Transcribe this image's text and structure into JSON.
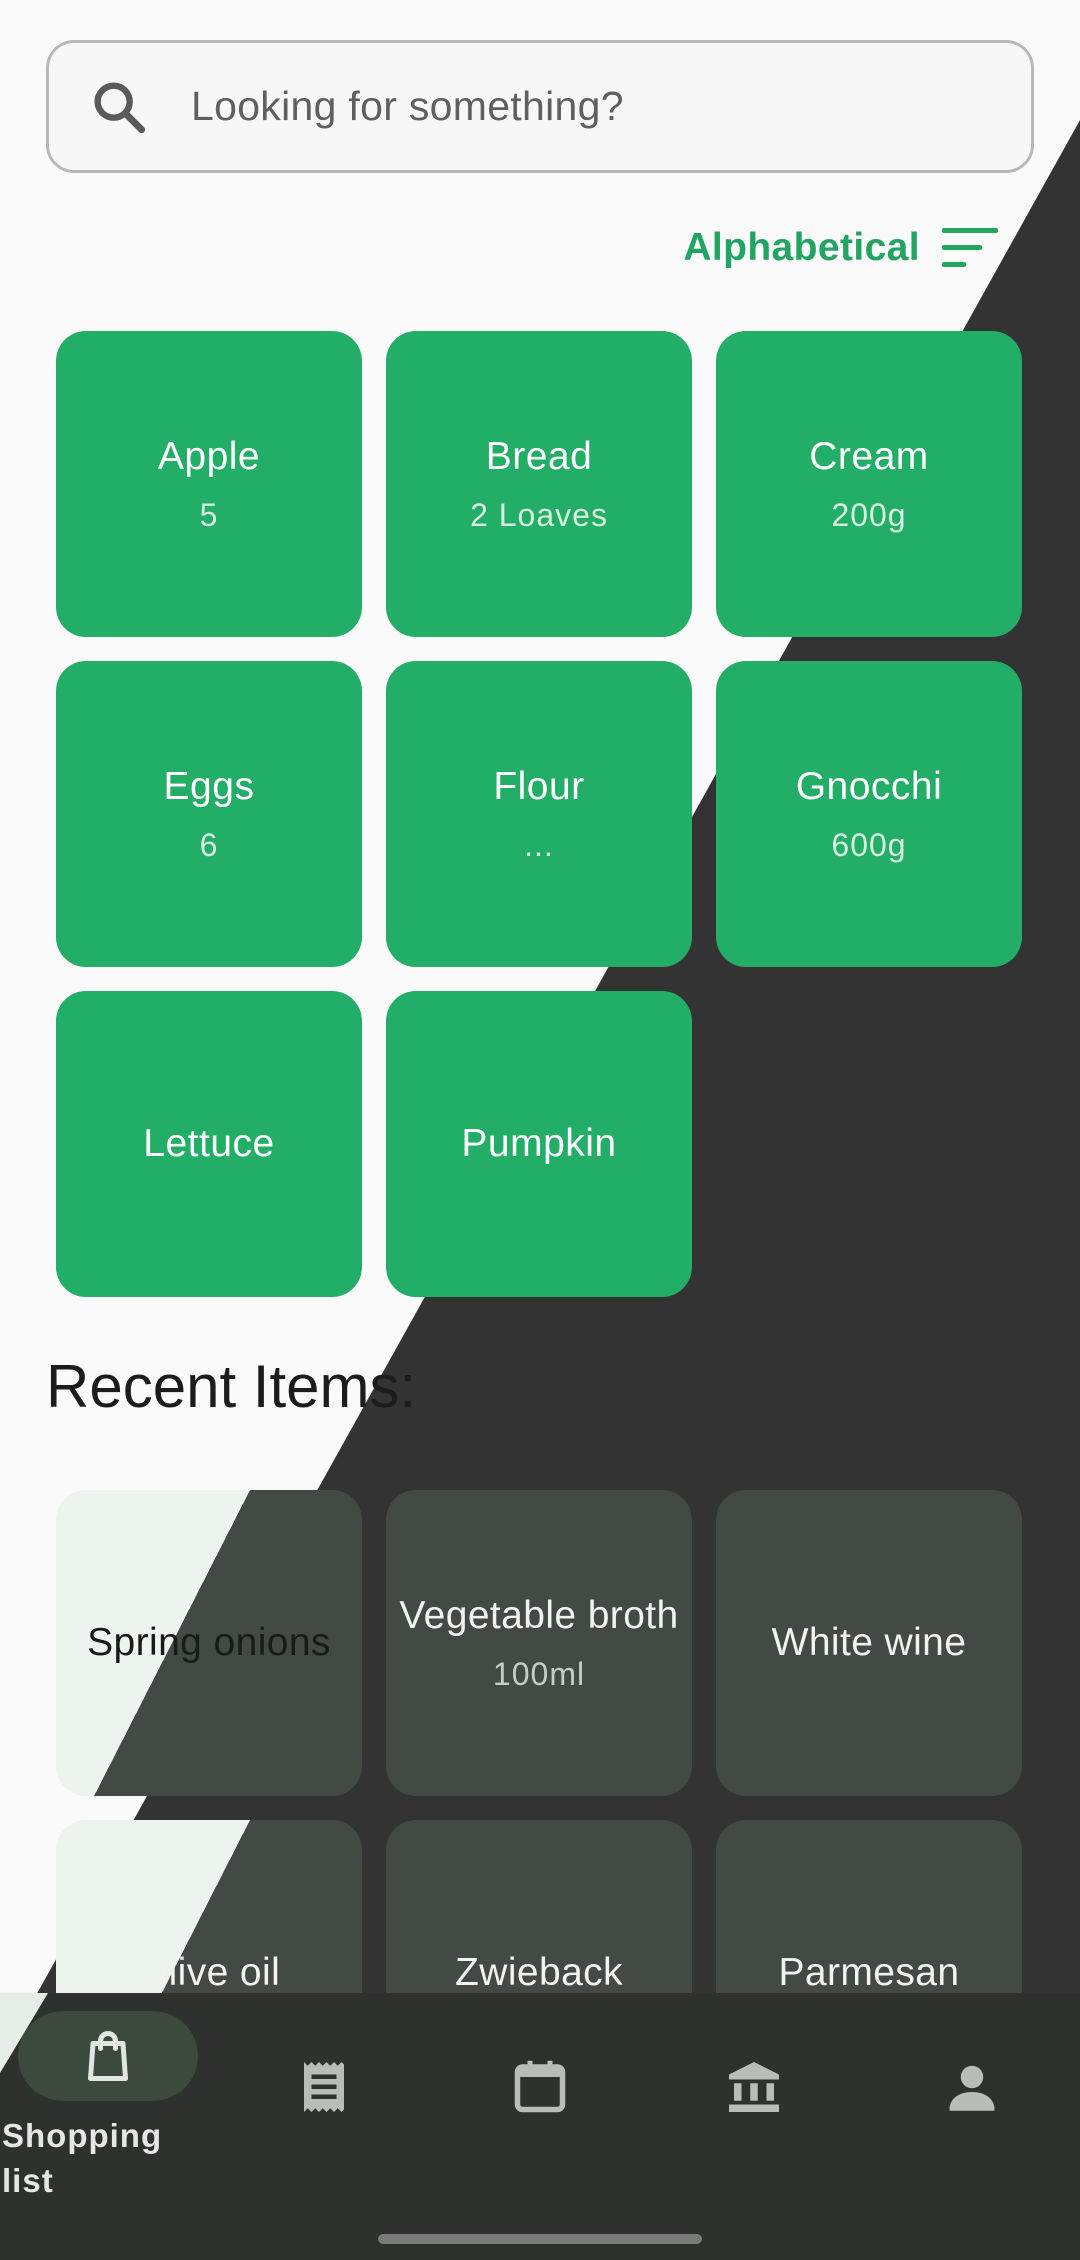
{
  "search": {
    "placeholder": "Looking for something?"
  },
  "sort": {
    "label": "Alphabetical"
  },
  "items": [
    {
      "name": "Apple",
      "qty": "5"
    },
    {
      "name": "Bread",
      "qty": "2 Loaves"
    },
    {
      "name": "Cream",
      "qty": "200g"
    },
    {
      "name": "Eggs",
      "qty": "6"
    },
    {
      "name": "Flour",
      "qty": "..."
    },
    {
      "name": "Gnocchi",
      "qty": "600g"
    },
    {
      "name": "Lettuce",
      "qty": ""
    },
    {
      "name": "Pumpkin",
      "qty": ""
    }
  ],
  "recent": {
    "title": "Recent Items:",
    "items": [
      {
        "name": "Spring onions",
        "qty": ""
      },
      {
        "name": "Vegetable broth",
        "qty": "100ml"
      },
      {
        "name": "White wine",
        "qty": ""
      },
      {
        "name": "Olive oil",
        "qty": ""
      },
      {
        "name": "Zwieback",
        "qty": ""
      },
      {
        "name": "Parmesan",
        "qty": ""
      }
    ]
  },
  "nav": {
    "items": [
      {
        "label": "Shopping list",
        "icon": "shopping-bag-icon",
        "active": true
      },
      {
        "label": "",
        "icon": "receipt-icon",
        "active": false
      },
      {
        "label": "",
        "icon": "calendar-icon",
        "active": false
      },
      {
        "label": "",
        "icon": "bank-icon",
        "active": false
      },
      {
        "label": "",
        "icon": "person-icon",
        "active": false
      }
    ]
  },
  "colors": {
    "accent": "#22ae66",
    "dark": "#333333",
    "recent_tile": "#434a43",
    "nav_bg": "#2e312e"
  }
}
